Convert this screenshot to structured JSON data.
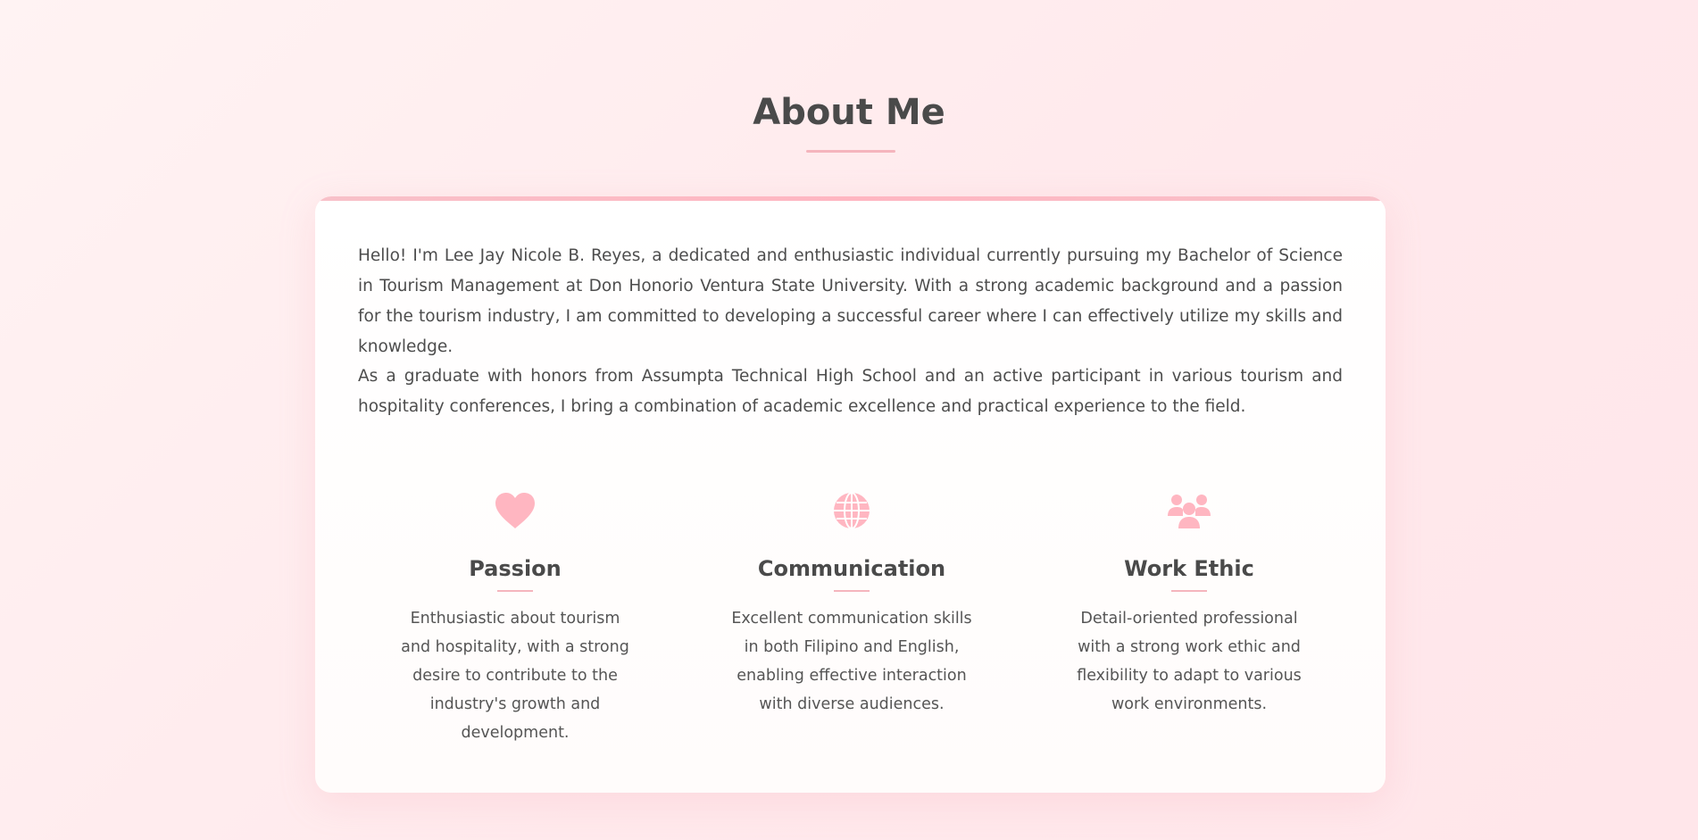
{
  "section": {
    "title": "About Me"
  },
  "intro": {
    "paragraph1": "Hello! I'm Lee Jay Nicole B. Reyes, a dedicated and enthusiastic individual currently pursuing my Bachelor of Science in Tourism Management at Don Honorio Ventura State University. With a strong academic background and a passion for the tourism industry, I am committed to developing a successful career where I can effectively utilize my skills and knowledge.",
    "paragraph2": "As a graduate with honors from Assumpta Technical High School and an active participant in various tourism and hospitality conferences, I bring a combination of academic excellence and practical experience to the field."
  },
  "features": [
    {
      "icon": "heart-icon",
      "title": "Passion",
      "description": "Enthusiastic about tourism and hospitality, with a strong desire to contribute to the industry's growth and development."
    },
    {
      "icon": "globe-icon",
      "title": "Communication",
      "description": "Excellent communication skills in both Filipino and English, enabling effective interaction with diverse audiences."
    },
    {
      "icon": "users-icon",
      "title": "Work Ethic",
      "description": "Detail-oriented professional with a strong work ethic and flexibility to adapt to various work environments."
    }
  ],
  "colors": {
    "accent": "#ffb6c1",
    "text": "#4a4a4a",
    "background": "#ffeef0"
  }
}
